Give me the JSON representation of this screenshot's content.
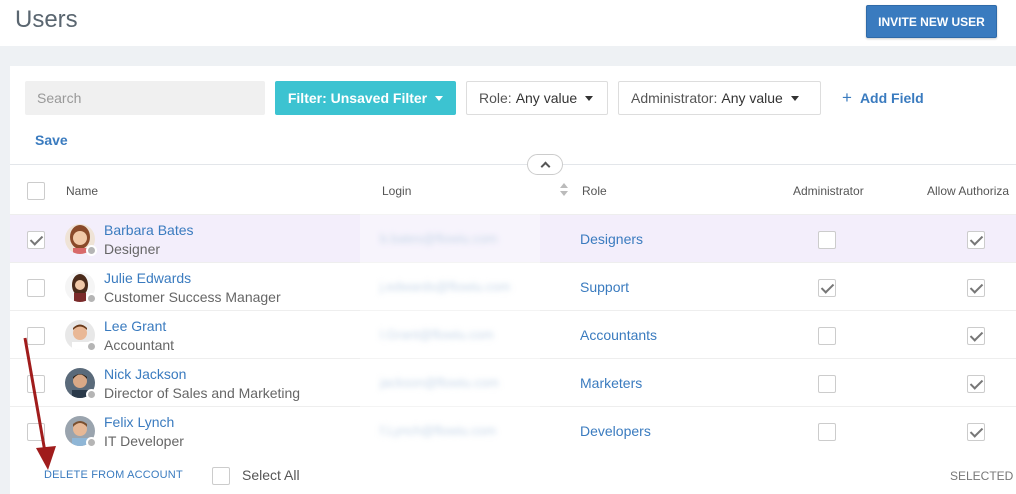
{
  "header": {
    "title": "Users",
    "invite_label": "INVITE NEW USER"
  },
  "toolbar": {
    "search_placeholder": "Search",
    "filter_label": "Filter: Unsaved Filter",
    "role_label": "Role:",
    "role_value": "Any value",
    "admin_label": "Administrator:",
    "admin_value": "Any value",
    "add_field_label": "Add Field",
    "save_label": "Save"
  },
  "table": {
    "columns": {
      "name": "Name",
      "login": "Login",
      "role": "Role",
      "administrator": "Administrator",
      "allow": "Allow Authoriza"
    },
    "rows": [
      {
        "name": "Barbara Bates",
        "title": "Designer",
        "login": "b.bates@flowiu.com",
        "role": "Designers",
        "selected": true,
        "admin": false,
        "allow": true
      },
      {
        "name": "Julie Edwards",
        "title": "Customer Success Manager",
        "login": "j.edwards@flowiu.com",
        "role": "Support",
        "selected": false,
        "admin": true,
        "allow": true
      },
      {
        "name": "Lee Grant",
        "title": "Accountant",
        "login": "l.Grant@flowiu.com",
        "role": "Accountants",
        "selected": false,
        "admin": false,
        "allow": true
      },
      {
        "name": "Nick Jackson",
        "title": "Director of Sales and Marketing",
        "login": "jackson@flowiu.com",
        "role": "Marketers",
        "selected": false,
        "admin": false,
        "allow": true
      },
      {
        "name": "Felix Lynch",
        "title": "IT Developer",
        "login": "f.Lynch@flowiu.com",
        "role": "Developers",
        "selected": false,
        "admin": false,
        "allow": true
      }
    ]
  },
  "footer": {
    "delete_label": "DELETE FROM ACCOUNT",
    "select_all_label": "Select All",
    "selected_label": "SELECTED :"
  },
  "colors": {
    "accent": "#3a7bbf",
    "filter": "#3cc3d1",
    "selected_row": "#f3eefb",
    "arrow": "#a01c1c"
  }
}
